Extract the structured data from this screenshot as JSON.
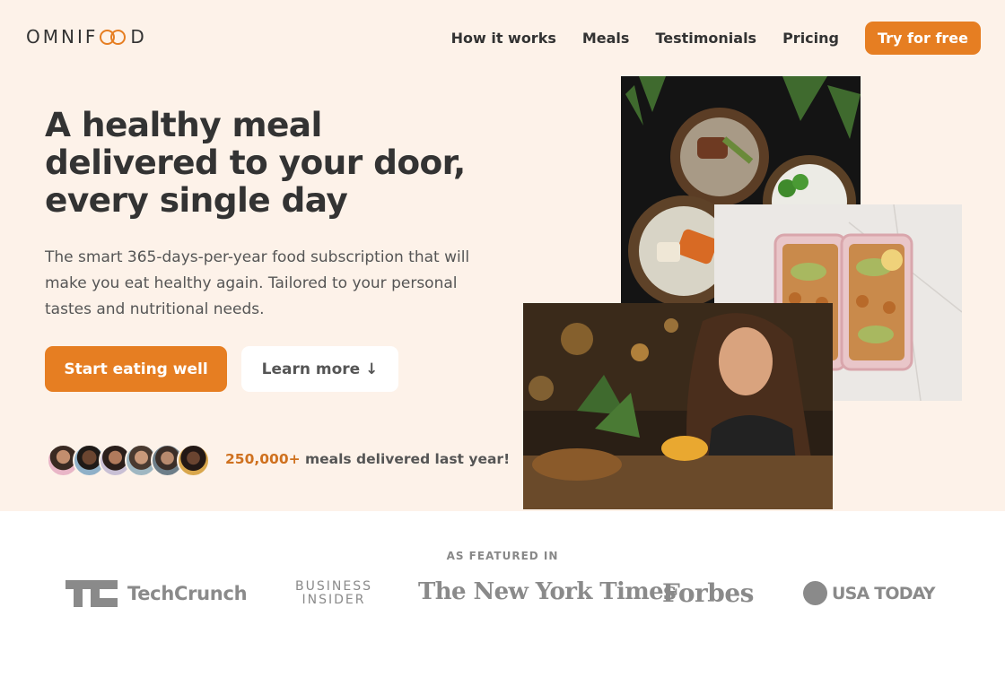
{
  "header": {
    "logo_left": "OMNIF",
    "logo_right": "D",
    "nav": [
      "How it works",
      "Meals",
      "Testimonials",
      "Pricing"
    ],
    "cta_label": "Try for free"
  },
  "hero": {
    "title": "A healthy meal delivered to your door, every single day",
    "description": "The smart 365-days-per-year food subscription that will make you eat healthy again. Tailored to your personal tastes and nutritional needs.",
    "primary_button": "Start eating well",
    "secondary_button": "Learn more ↓",
    "delivered_count": "250,000+",
    "delivered_text": "meals delivered last year!"
  },
  "featured": {
    "heading": "AS FEATURED IN",
    "logos": [
      "TechCrunch",
      "BUSINESS",
      "INSIDER",
      "The New York Times",
      "Forbes",
      "USA TODAY"
    ]
  },
  "colors": {
    "brand": "#e67e22",
    "hero_bg": "#fdf2e9",
    "text": "#333333"
  }
}
